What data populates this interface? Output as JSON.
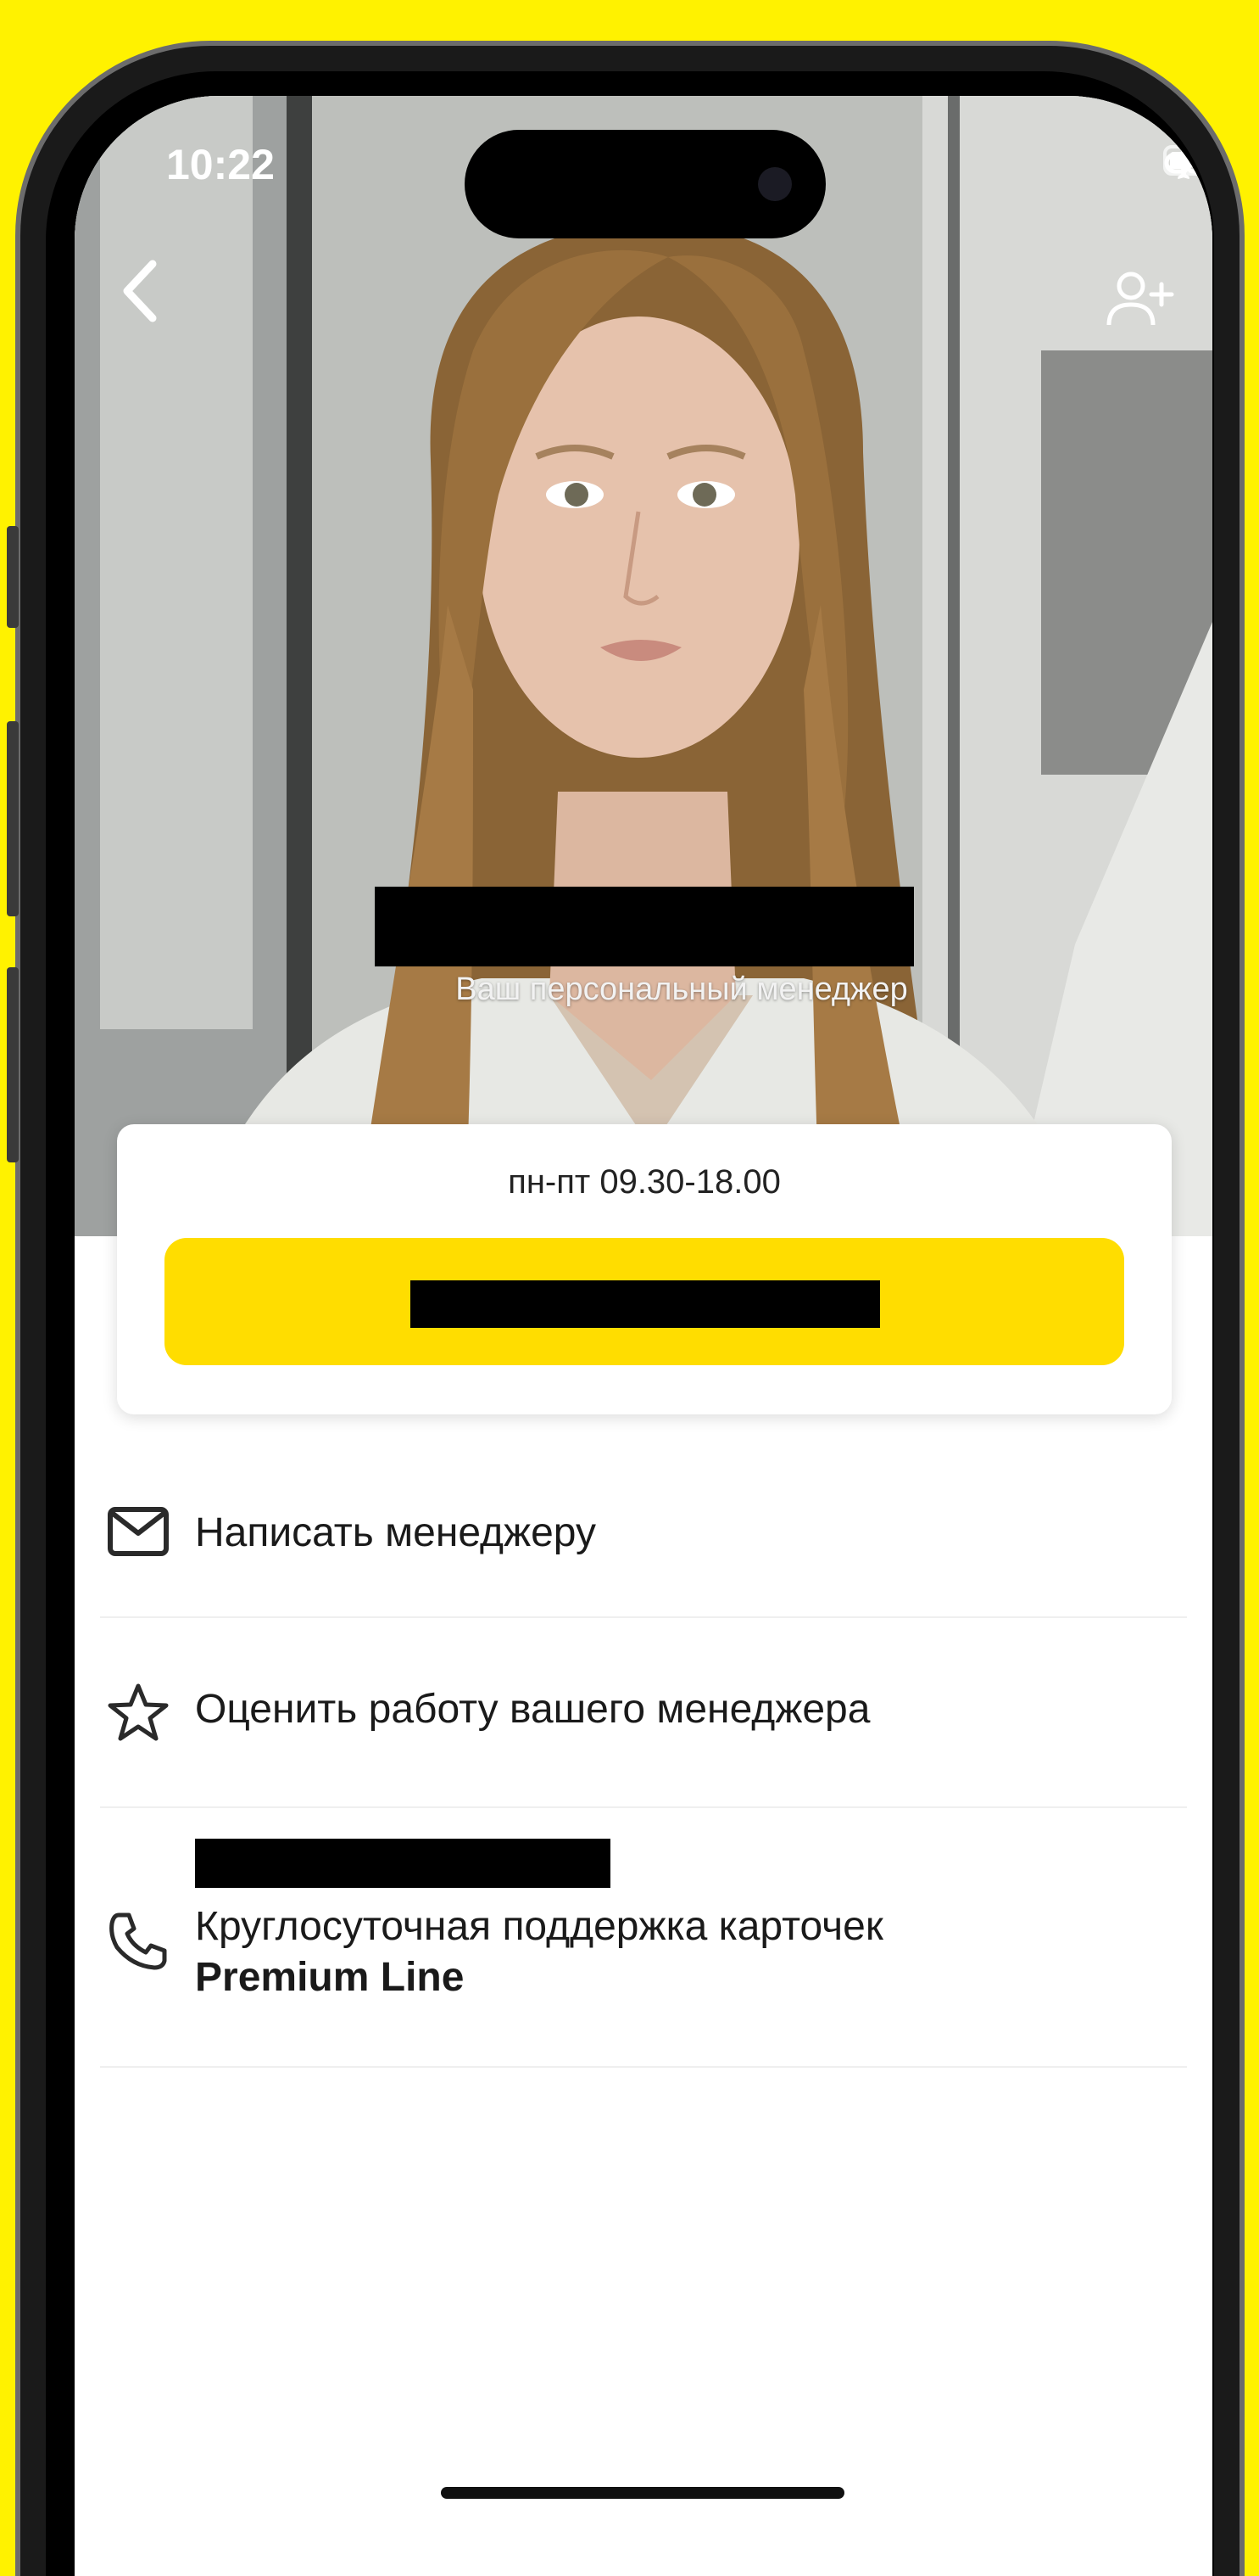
{
  "status_bar": {
    "time": "10:22",
    "icons": [
      "airplane-icon",
      "link-icon",
      "battery-icon"
    ]
  },
  "header": {
    "back_icon": "chevron-left-icon",
    "add_contact_icon": "add-user-icon"
  },
  "manager": {
    "subtitle": "Ваш персональный менеджер"
  },
  "card": {
    "hours": "пн-пт 09.30-18.00"
  },
  "list": {
    "items": [
      {
        "icon": "mail-icon",
        "label": "Написать менеджеру"
      },
      {
        "icon": "star-icon",
        "label": "Оценить работу вашего менеджера"
      },
      {
        "icon": "phone-icon",
        "label": "Круглосуточная поддержка карточек",
        "label_bold": "Premium Line"
      }
    ]
  },
  "colors": {
    "background": "#FFF200",
    "accent": "#FFDD00"
  }
}
